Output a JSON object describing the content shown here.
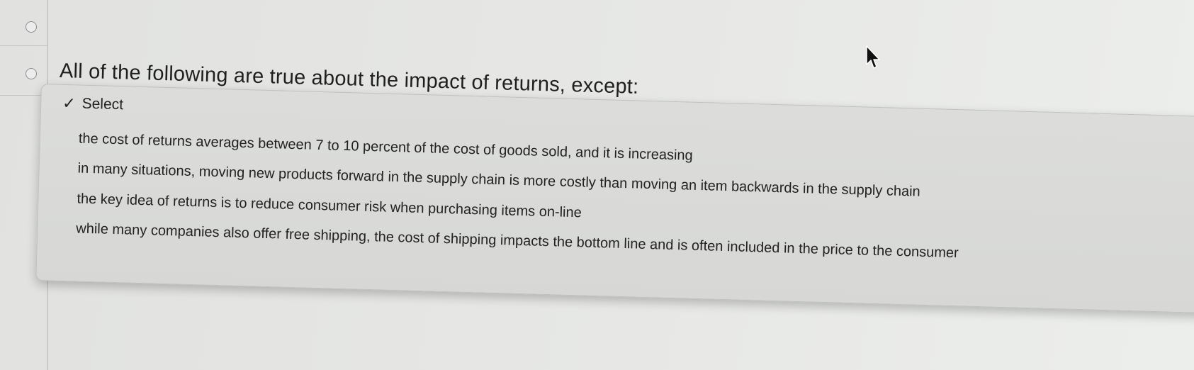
{
  "question": {
    "text": "All of the following are true about the impact of returns, except:"
  },
  "dropdown": {
    "selected_label": "Select",
    "selected_icon": "checkmark-icon",
    "options": [
      "the cost of returns averages between 7 to 10 percent of the cost of goods sold, and it is increasing",
      "in many situations, moving new products forward in the supply chain is more costly than moving an item backwards in the supply chain",
      "the key idea of returns is to reduce consumer risk when purchasing items on-line",
      "while many companies also offer free shipping, the cost of shipping impacts the bottom line and is often included in the price to the consumer"
    ]
  },
  "icons": {
    "radio": "radio-button-icon",
    "cursor": "mouse-pointer-icon"
  },
  "colors": {
    "background": "#e6e7e5",
    "menu_background": "#d9dad8",
    "text": "#222222"
  }
}
